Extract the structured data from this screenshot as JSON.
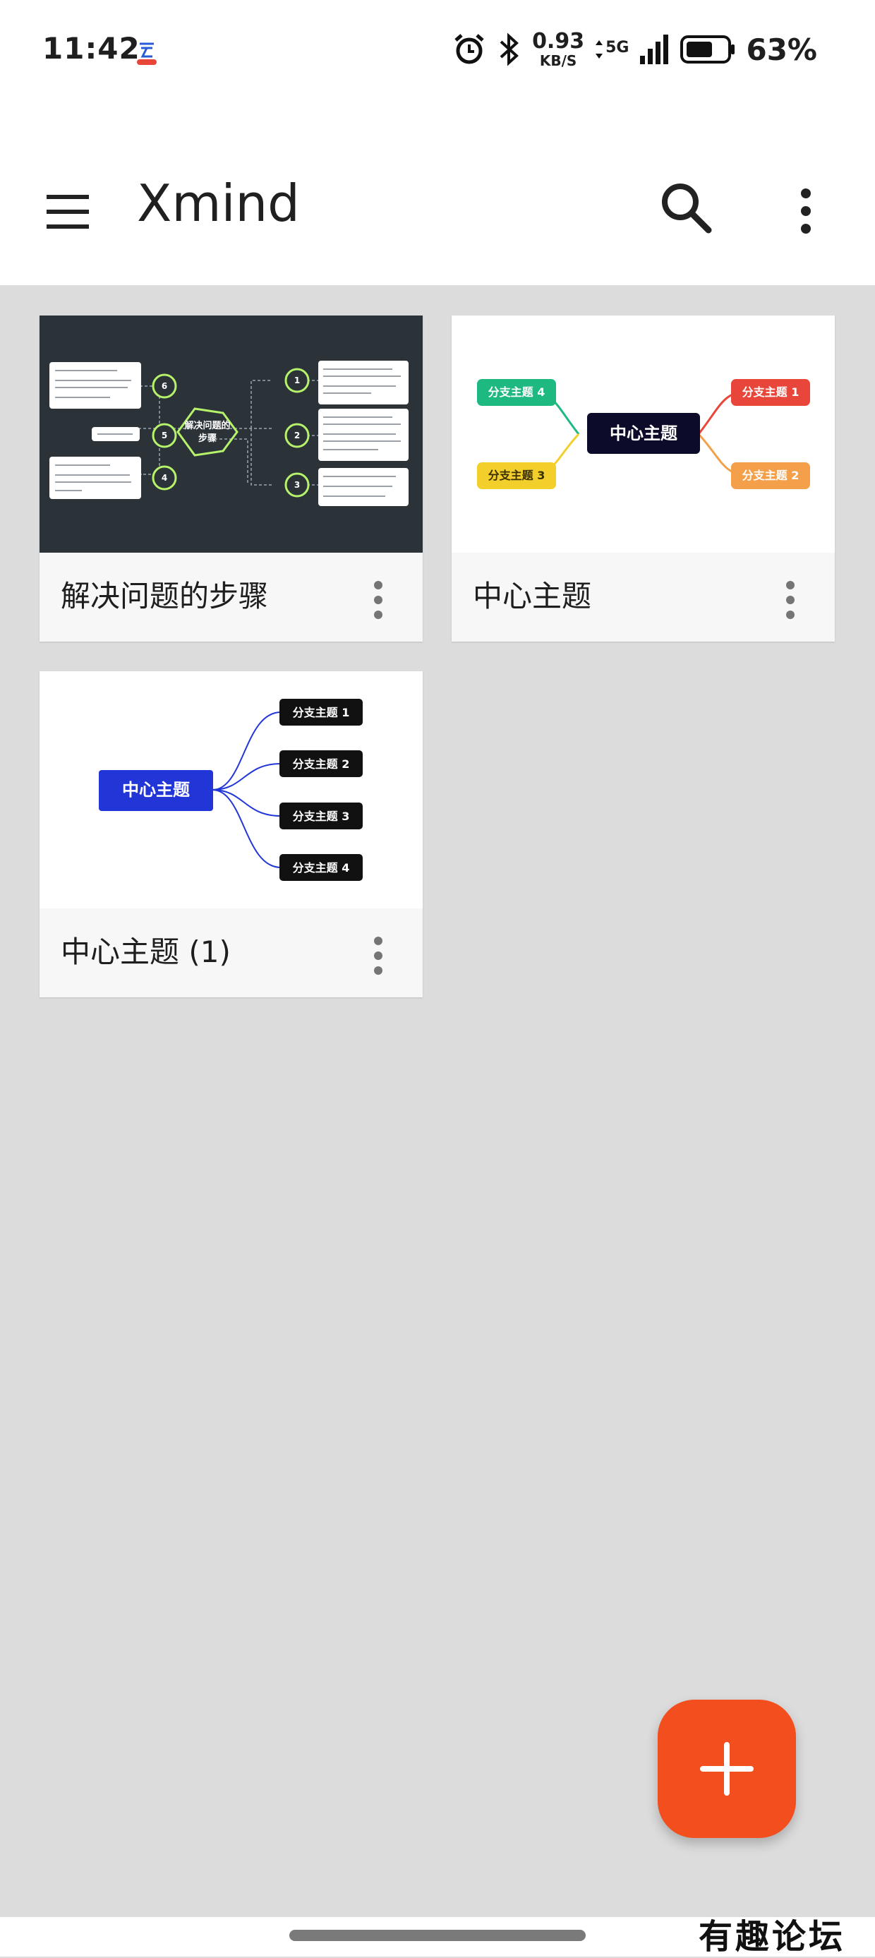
{
  "status_bar": {
    "time": "11:42",
    "net_speed_value": "0.93",
    "net_speed_unit": "KB/S",
    "network_type": "5G",
    "battery_percent": "63%",
    "icons": [
      "alarm-icon",
      "bluetooth-icon",
      "signal-icon",
      "battery-icon"
    ]
  },
  "app_bar": {
    "title": "Xmind",
    "icons": [
      "menu-icon",
      "search-icon",
      "more-vertical-icon"
    ]
  },
  "files": [
    {
      "title": "解决问题的步骤",
      "thumbnail": {
        "central": "解决问题的步骤",
        "central_line1": "解决问题的",
        "central_line2": "步骤",
        "numbers": [
          "1",
          "2",
          "3",
          "4",
          "5",
          "6"
        ]
      }
    },
    {
      "title": "中心主题",
      "thumbnail": {
        "central": "中心主题",
        "branches": [
          "分支主题 1",
          "分支主题 2",
          "分支主题 3",
          "分支主题 4"
        ]
      }
    },
    {
      "title": "中心主题 (1)",
      "thumbnail": {
        "central": "中心主题",
        "branches": [
          "分支主题 1",
          "分支主题 2",
          "分支主题 3",
          "分支主题 4"
        ]
      }
    }
  ],
  "fab": {
    "icon": "plus-icon"
  },
  "watermark": "有趣论坛",
  "colors": {
    "fab": "#f24e1e",
    "thumb1_bg": "#2b3339",
    "thumb1_accent": "#b6f36b",
    "branch1": "#e8463a",
    "branch2": "#f4a04a",
    "branch3": "#f2cf2a",
    "branch4": "#1eb980",
    "central_dark": "#0c0c2a",
    "central_blue": "#2236d8"
  }
}
